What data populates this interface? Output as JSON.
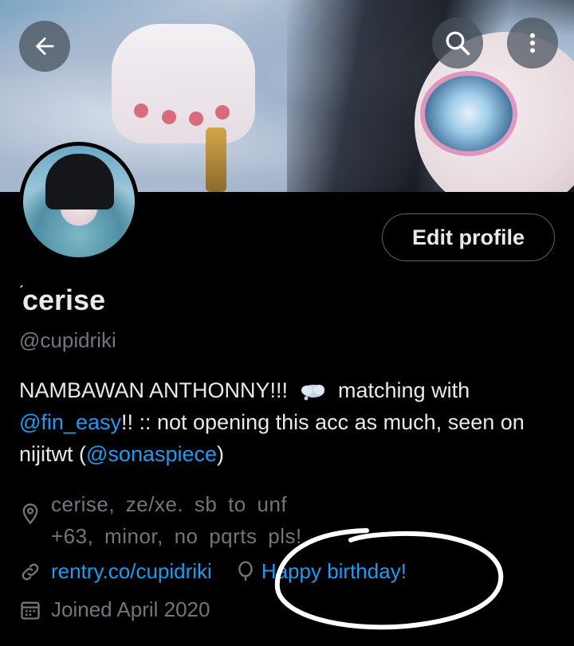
{
  "header": {
    "back_icon": "arrow-left-icon",
    "search_icon": "search-icon",
    "more_icon": "more-vertical-icon"
  },
  "profile": {
    "edit_label": "Edit profile",
    "display_name": "cerise",
    "name_mark": "́",
    "handle": "@cupidriki",
    "bio": {
      "part1": "NAMBAWAN ANTHONNY!!! ",
      "part2": " matching with",
      "mention1": "@fin_easy",
      "part3": "!! :: not opening this acc as much, seen on nijitwt (",
      "mention2": "@sonaspiece",
      "part4": ")"
    },
    "location_line1": "cerise,  ze/xe. sb  to  unf",
    "location_line2": "+63,  minor,  no  pqrts  pls!",
    "website": "rentry.co/cupidriki",
    "birthday": "Happy birthday!",
    "joined": "Joined April 2020"
  },
  "colors": {
    "accent": "#1d9bf0",
    "muted": "#71767b",
    "text": "#e7e9ea",
    "border": "#536471"
  }
}
